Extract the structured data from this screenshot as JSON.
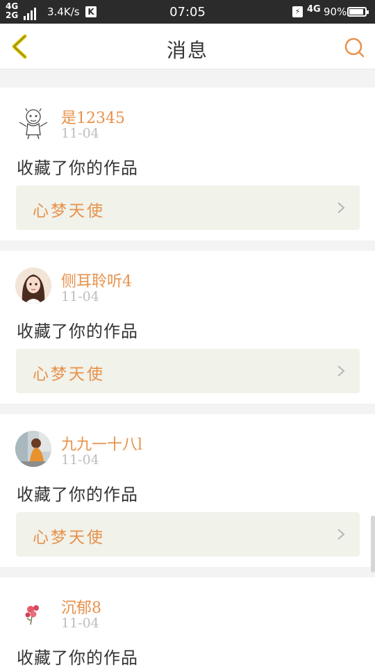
{
  "status_bar": {
    "network_top": "4G",
    "network_bottom": "2G",
    "speed": "3.4K/s",
    "k_badge": "K",
    "time": "07:05",
    "network_right": "4G",
    "battery_percent": "90%",
    "battery_level": 0.9
  },
  "header": {
    "back_icon": "chevron-left-icon",
    "title": "消息",
    "search_icon": "search-icon"
  },
  "colors": {
    "accent": "#e8914a",
    "back_arrow": "#d9c400",
    "work_box_bg": "#f1f2ea"
  },
  "messages": [
    {
      "username": "是12345",
      "date": "11-04",
      "text": "收藏了你的作品",
      "work": "心梦天使",
      "avatar": "tiger-sketch-avatar"
    },
    {
      "username": "侧耳聆听4",
      "date": "11-04",
      "text": "收藏了你的作品",
      "work": "心梦天使",
      "avatar": "girl-portrait-avatar"
    },
    {
      "username": "九九一十八l",
      "date": "11-04",
      "text": "收藏了你的作品",
      "work": "心梦天使",
      "avatar": "girl-photo-avatar"
    },
    {
      "username": "沉郁8",
      "date": "11-04",
      "text": "收藏了你的作品",
      "avatar": "flower-avatar"
    }
  ]
}
